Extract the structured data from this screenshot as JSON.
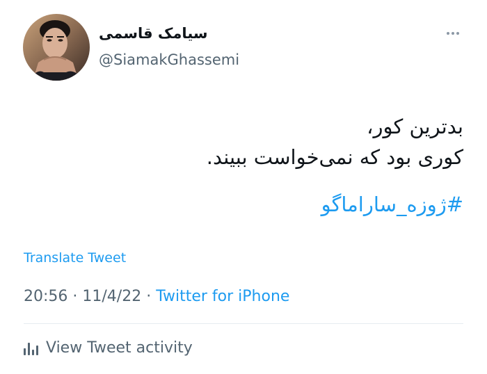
{
  "tweet": {
    "author": {
      "display_name": "سیامک قاسمی",
      "handle": "@SiamakGhassemi",
      "avatar_icon": "profile-photo"
    },
    "more_icon": "ellipsis-icon",
    "text_lines": [
      "بدترین کور،",
      "کوری بود که نمی‌خواست ببیند."
    ],
    "hashtag": "#ژوزه_ساراماگو",
    "translate_label": "Translate Tweet",
    "time": "20:56",
    "separator": " · ",
    "date": "11/4/22",
    "source": "Twitter for iPhone",
    "activity_label": "View Tweet activity",
    "activity_icon": "bar-chart-icon"
  },
  "colors": {
    "text": "#0f1419",
    "secondary": "#536471",
    "link": "#1d9bf0",
    "divider": "#e6ecf0"
  }
}
